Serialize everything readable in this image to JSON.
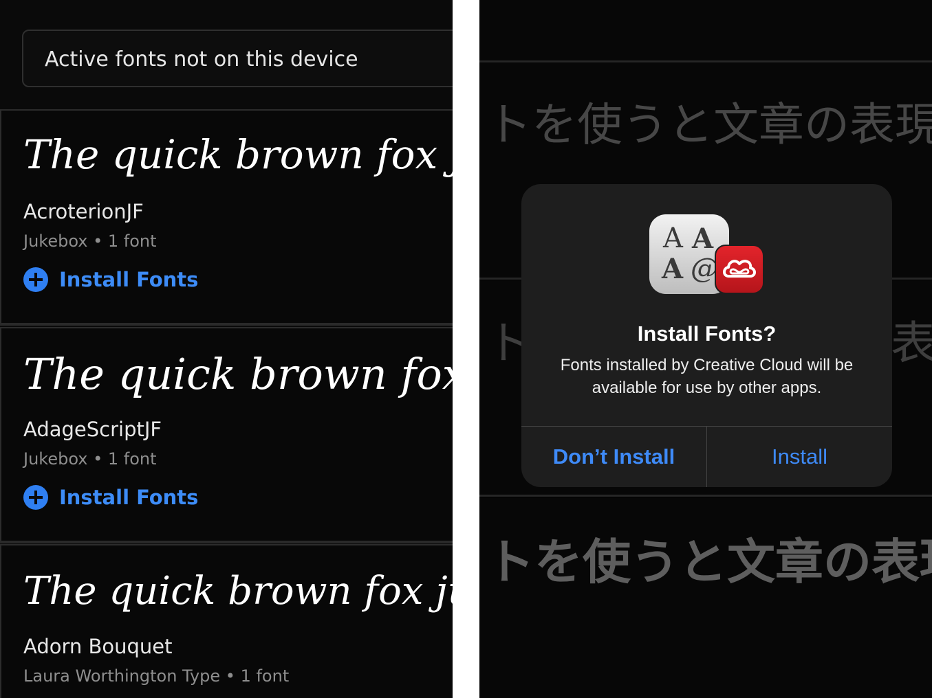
{
  "left": {
    "filter_label": "Active fonts not on this device",
    "fonts": [
      {
        "sample": "The quick brown fox jumps over",
        "name": "AcroterionJF",
        "meta": "Jukebox • 1 font",
        "install_label": "Install Fonts"
      },
      {
        "sample": "The quick brown fox jumps over",
        "name": "AdageScriptJF",
        "meta": "Jukebox • 1 font",
        "install_label": "Install Fonts"
      },
      {
        "sample": "The quick brown fox jumps over",
        "name": "Adorn Bouquet",
        "meta": "Laura Worthington Type • 1 font"
      }
    ]
  },
  "right": {
    "bg_text_1": "トを使うと文章の表現",
    "bg_text_2_left": "ト",
    "bg_text_2_right": "表現",
    "bg_text_3": "トを使うと文章の表現",
    "dialog": {
      "icon_letters": [
        "A",
        "A",
        "A",
        "@"
      ],
      "title": "Install Fonts?",
      "message": "Fonts installed by Creative Cloud will be available for use by other apps.",
      "cancel_label": "Don’t Install",
      "confirm_label": "Install"
    }
  },
  "colors": {
    "accent_blue": "#3d8cf7",
    "background": "#0a0a0a",
    "dialog_bg": "#1e1e1e",
    "cc_red": "#d81e24"
  }
}
